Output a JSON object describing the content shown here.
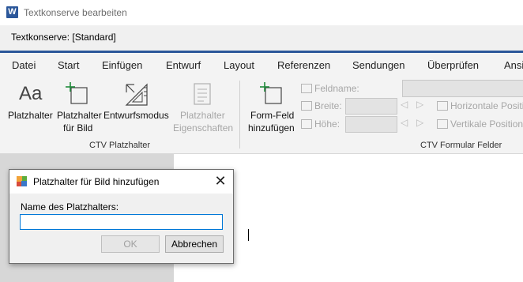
{
  "window": {
    "app_icon": "W",
    "title": "Textkonserve bearbeiten"
  },
  "document": {
    "name_label": "Textkonserve: [Standard]"
  },
  "ribbon": {
    "accent_color": "#2b579a",
    "tabs": [
      "Datei",
      "Start",
      "Einfügen",
      "Entwurf",
      "Layout",
      "Referenzen",
      "Sendungen",
      "Überprüfen",
      "Ansi"
    ],
    "group1": {
      "label": "CTV Platzhalter",
      "buttons": [
        {
          "label": "Platzhalter",
          "icon_glyph": "Aa",
          "icon": "text-placeholder-icon"
        },
        {
          "label": "Platzhalter für Bild",
          "line1": "Platzhalter",
          "line2": "für Bild",
          "icon": "add-image-placeholder-icon"
        },
        {
          "label": "Entwurfsmodus",
          "icon": "design-mode-icon"
        },
        {
          "label": "Platzhalter Eigenschaften",
          "line1": "Platzhalter",
          "line2": "Eigenschaften",
          "icon": "properties-icon",
          "disabled": true
        }
      ]
    },
    "group2": {
      "label": "CTV Formular Felder",
      "form_field_button": {
        "line1": "Form-Feld",
        "line2": "hinzufügen",
        "icon": "add-form-field-icon"
      },
      "fields": {
        "feldname": "Feldname:",
        "breite": "Breite:",
        "hoehe": "Höhe:",
        "horizontal": "Horizontale Positi",
        "vertical": "Vertikale Position"
      }
    }
  },
  "dialog": {
    "title": "Platzhalter für Bild hinzufügen",
    "close_glyph": "✕",
    "name_label": "Name des Platzhalters:",
    "name_value": "",
    "ok_label": "OK",
    "cancel_label": "Abbrechen"
  }
}
